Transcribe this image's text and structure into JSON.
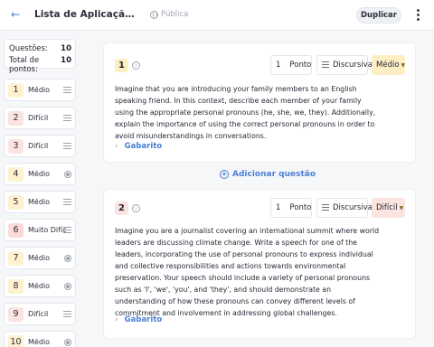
{
  "header": {
    "back_icon": "arrow-left-icon",
    "title": "Lista de Aplicação | Pronomes",
    "visibility": "Pública",
    "duplicate_label": "Duplicar"
  },
  "summary": {
    "questions_label": "Questões:",
    "questions_value": "10",
    "points_label": "Total de pontos:",
    "points_value": "10"
  },
  "sidebar": {
    "items": [
      {
        "num": "1",
        "label": "Médio",
        "icon": "lines-icon",
        "color": "#fdf1cf"
      },
      {
        "num": "2",
        "label": "Difícil",
        "icon": "lines-icon",
        "color": "#fbe3e0"
      },
      {
        "num": "3",
        "label": "Difícil",
        "icon": "lines-icon",
        "color": "#fbe3e0"
      },
      {
        "num": "4",
        "label": "Médio",
        "icon": "radio-icon",
        "color": "#fdf1cf"
      },
      {
        "num": "5",
        "label": "Médio",
        "icon": "lines-icon",
        "color": "#fdf1cf"
      },
      {
        "num": "6",
        "label": "Muito Difícil",
        "icon": "lines-icon",
        "color": "#fbd9d6"
      },
      {
        "num": "7",
        "label": "Médio",
        "icon": "radio-icon",
        "color": "#fdf1cf"
      },
      {
        "num": "8",
        "label": "Médio",
        "icon": "radio-icon",
        "color": "#fdf1cf"
      },
      {
        "num": "9",
        "label": "Difícil",
        "icon": "lines-icon",
        "color": "#fbe3e0"
      },
      {
        "num": "10",
        "label": "Médio",
        "icon": "radio-icon",
        "color": "#fdf1cf"
      }
    ]
  },
  "questions": [
    {
      "num": "1",
      "points": "1",
      "points_label": "Ponto",
      "type": "Discursiva",
      "difficulty": "Médio",
      "difficulty_color": "#fdeec4",
      "num_color": "#fdeec4",
      "text": "Imagine that you are introducing your family members to an English speaking friend. In this context, describe each member of your family using the appropriate personal pronouns (he, she, we, they). Additionally, explain the importance of using the correct personal pronouns in order to avoid misunderstandings in conversations.",
      "answer_label": "Gabarito"
    },
    {
      "num": "2",
      "points": "1",
      "points_label": "Ponto",
      "type": "Discursiva",
      "difficulty": "Difícil",
      "difficulty_color": "#fbe3e0",
      "num_color": "#fbe3e0",
      "text": "Imagine you are a journalist covering an international summit where world leaders are discussing climate change. Write a speech for one of the leaders, incorporating the use of personal pronouns to express individual and collective responsibilities and actions towards environmental preservation. Your speech should include a variety of personal pronouns such as 'I', 'we', 'you', and 'they', and should demonstrate an understanding of how these pronouns can convey different levels of commitment and involvement in addressing global challenges.",
      "answer_label": "Gabarito"
    }
  ],
  "add_question_label": "Adicionar questão"
}
